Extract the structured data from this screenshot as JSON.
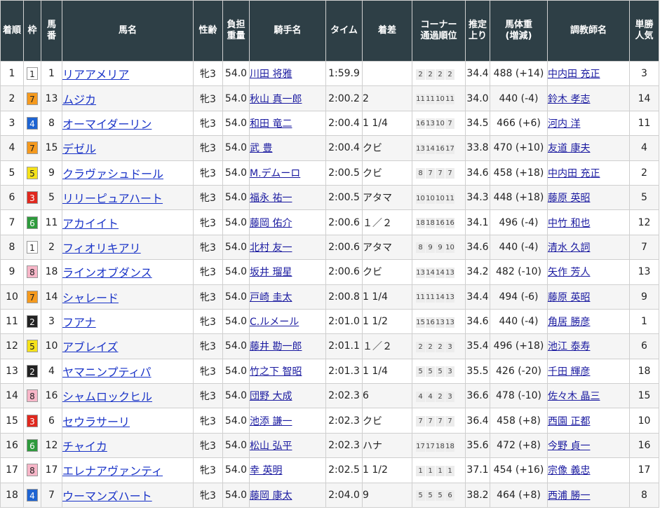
{
  "headers": {
    "rank": "着順",
    "waku": "枠",
    "num": "馬番",
    "horse": "馬名",
    "sexage": "性齢",
    "weight": "負担重量",
    "jockey": "騎手名",
    "time": "タイム",
    "margin": "着差",
    "corner_l1": "コーナー",
    "corner_l2": "通過順位",
    "last3f": "推定上り",
    "body_l1": "馬体重",
    "body_l2": "(増減)",
    "trainer": "調教師名",
    "pop": "単勝人気"
  },
  "waku_colors": {
    "1": {
      "bg": "#ffffff",
      "fg": "#222222"
    },
    "2": {
      "bg": "#222222",
      "fg": "#ffffff"
    },
    "3": {
      "bg": "#e0281e",
      "fg": "#ffffff"
    },
    "4": {
      "bg": "#1e64d2",
      "fg": "#ffffff"
    },
    "5": {
      "bg": "#f5e21a",
      "fg": "#222222"
    },
    "6": {
      "bg": "#2e9a3c",
      "fg": "#ffffff"
    },
    "7": {
      "bg": "#f59a1e",
      "fg": "#222222"
    },
    "8": {
      "bg": "#f7b6c8",
      "fg": "#222222"
    }
  },
  "rows": [
    {
      "rank": "1",
      "waku": "1",
      "num": "1",
      "horse": "リアアメリア",
      "sexage": "牝3",
      "weight": "54.0",
      "jockey": "川田 将雅",
      "time": "1:59.9",
      "margin": "",
      "corner": [
        "2",
        "2",
        "2",
        "2"
      ],
      "last3f": "34.4",
      "body": "488 (+14)",
      "trainer": "中内田 充正",
      "pop": "3"
    },
    {
      "rank": "2",
      "waku": "7",
      "num": "13",
      "horse": "ムジカ",
      "sexage": "牝3",
      "weight": "54.0",
      "jockey": "秋山 真一郎",
      "time": "2:00.2",
      "margin": "2",
      "corner": [
        "11",
        "11",
        "10",
        "11"
      ],
      "last3f": "34.0",
      "body": "440 (-4)",
      "trainer": "鈴木 孝志",
      "pop": "14"
    },
    {
      "rank": "3",
      "waku": "4",
      "num": "8",
      "horse": "オーマイダーリン",
      "sexage": "牝3",
      "weight": "54.0",
      "jockey": "和田 竜二",
      "time": "2:00.4",
      "margin": "1 1/4",
      "corner": [
        "16",
        "13",
        "10",
        "7"
      ],
      "last3f": "34.5",
      "body": "466 (+6)",
      "trainer": "河内 洋",
      "pop": "11"
    },
    {
      "rank": "4",
      "waku": "7",
      "num": "15",
      "horse": "デゼル",
      "sexage": "牝3",
      "weight": "54.0",
      "jockey": "武 豊",
      "time": "2:00.4",
      "margin": "クビ",
      "corner": [
        "13",
        "14",
        "16",
        "17"
      ],
      "last3f": "33.8",
      "body": "470 (+10)",
      "trainer": "友道 康夫",
      "pop": "4"
    },
    {
      "rank": "5",
      "waku": "5",
      "num": "9",
      "horse": "クラヴァシュドール",
      "sexage": "牝3",
      "weight": "54.0",
      "jockey": "M.デムーロ",
      "time": "2:00.5",
      "margin": "クビ",
      "corner": [
        "8",
        "7",
        "7",
        "7"
      ],
      "last3f": "34.6",
      "body": "458 (+18)",
      "trainer": "中内田 充正",
      "pop": "2"
    },
    {
      "rank": "6",
      "waku": "3",
      "num": "5",
      "horse": "リリーピュアハート",
      "sexage": "牝3",
      "weight": "54.0",
      "jockey": "福永 祐一",
      "time": "2:00.5",
      "margin": "アタマ",
      "corner": [
        "10",
        "10",
        "10",
        "11"
      ],
      "last3f": "34.3",
      "body": "448 (+18)",
      "trainer": "藤原 英昭",
      "pop": "5"
    },
    {
      "rank": "7",
      "waku": "6",
      "num": "11",
      "horse": "アカイイト",
      "sexage": "牝3",
      "weight": "54.0",
      "jockey": "藤岡 佑介",
      "time": "2:00.6",
      "margin": "１／２",
      "corner": [
        "18",
        "18",
        "16",
        "16"
      ],
      "last3f": "34.1",
      "body": "496 (-4)",
      "trainer": "中竹 和也",
      "pop": "12"
    },
    {
      "rank": "8",
      "waku": "1",
      "num": "2",
      "horse": "フィオリキアリ",
      "sexage": "牝3",
      "weight": "54.0",
      "jockey": "北村 友一",
      "time": "2:00.6",
      "margin": "アタマ",
      "corner": [
        "8",
        "9",
        "9",
        "10"
      ],
      "last3f": "34.6",
      "body": "440 (-4)",
      "trainer": "清水 久詞",
      "pop": "7"
    },
    {
      "rank": "9",
      "waku": "8",
      "num": "18",
      "horse": "ラインオブダンス",
      "sexage": "牝3",
      "weight": "54.0",
      "jockey": "坂井 瑠星",
      "time": "2:00.6",
      "margin": "クビ",
      "corner": [
        "13",
        "14",
        "14",
        "13"
      ],
      "last3f": "34.2",
      "body": "482 (-10)",
      "trainer": "矢作 芳人",
      "pop": "13"
    },
    {
      "rank": "10",
      "waku": "7",
      "num": "14",
      "horse": "シャレード",
      "sexage": "牝3",
      "weight": "54.0",
      "jockey": "戸崎 圭太",
      "time": "2:00.8",
      "margin": "1 1/4",
      "corner": [
        "11",
        "11",
        "14",
        "13"
      ],
      "last3f": "34.4",
      "body": "494 (-6)",
      "trainer": "藤原 英昭",
      "pop": "9"
    },
    {
      "rank": "11",
      "waku": "2",
      "num": "3",
      "horse": "フアナ",
      "sexage": "牝3",
      "weight": "54.0",
      "jockey": "C.ルメール",
      "time": "2:01.0",
      "margin": "1 1/2",
      "corner": [
        "15",
        "16",
        "13",
        "13"
      ],
      "last3f": "34.6",
      "body": "440 (-4)",
      "trainer": "角居 勝彦",
      "pop": "1"
    },
    {
      "rank": "12",
      "waku": "5",
      "num": "10",
      "horse": "アブレイズ",
      "sexage": "牝3",
      "weight": "54.0",
      "jockey": "藤井 勘一郎",
      "time": "2:01.1",
      "margin": "１／２",
      "corner": [
        "2",
        "2",
        "2",
        "3"
      ],
      "last3f": "35.4",
      "body": "496 (+18)",
      "trainer": "池江 泰寿",
      "pop": "6"
    },
    {
      "rank": "13",
      "waku": "2",
      "num": "4",
      "horse": "ヤマニンプティパ",
      "sexage": "牝3",
      "weight": "54.0",
      "jockey": "竹之下 智昭",
      "time": "2:01.3",
      "margin": "1 1/4",
      "corner": [
        "5",
        "5",
        "5",
        "3"
      ],
      "last3f": "35.5",
      "body": "426 (-20)",
      "trainer": "千田 輝彦",
      "pop": "18"
    },
    {
      "rank": "14",
      "waku": "8",
      "num": "16",
      "horse": "シャムロックヒル",
      "sexage": "牝3",
      "weight": "54.0",
      "jockey": "団野 大成",
      "time": "2:02.3",
      "margin": "6",
      "corner": [
        "4",
        "4",
        "2",
        "3"
      ],
      "last3f": "36.6",
      "body": "478 (-10)",
      "trainer": "佐々木 晶三",
      "pop": "15"
    },
    {
      "rank": "15",
      "waku": "3",
      "num": "6",
      "horse": "セウラサーリ",
      "sexage": "牝3",
      "weight": "54.0",
      "jockey": "池添 謙一",
      "time": "2:02.3",
      "margin": "クビ",
      "corner": [
        "7",
        "7",
        "7",
        "7"
      ],
      "last3f": "36.4",
      "body": "458 (+8)",
      "trainer": "西園 正都",
      "pop": "10"
    },
    {
      "rank": "16",
      "waku": "6",
      "num": "12",
      "horse": "チャイカ",
      "sexage": "牝3",
      "weight": "54.0",
      "jockey": "松山 弘平",
      "time": "2:02.3",
      "margin": "ハナ",
      "corner": [
        "17",
        "17",
        "18",
        "18"
      ],
      "last3f": "35.6",
      "body": "472 (+8)",
      "trainer": "今野 貞一",
      "pop": "16"
    },
    {
      "rank": "17",
      "waku": "8",
      "num": "17",
      "horse": "エレナアヴァンティ",
      "sexage": "牝3",
      "weight": "54.0",
      "jockey": "幸 英明",
      "time": "2:02.5",
      "margin": "1 1/2",
      "corner": [
        "1",
        "1",
        "1",
        "1"
      ],
      "last3f": "37.1",
      "body": "454 (+16)",
      "trainer": "宗像 義忠",
      "pop": "17"
    },
    {
      "rank": "18",
      "waku": "4",
      "num": "7",
      "horse": "ウーマンズハート",
      "sexage": "牝3",
      "weight": "54.0",
      "jockey": "藤岡 康太",
      "time": "2:04.0",
      "margin": "9",
      "corner": [
        "5",
        "5",
        "5",
        "6"
      ],
      "last3f": "38.2",
      "body": "464 (+8)",
      "trainer": "西浦 勝一",
      "pop": "8"
    }
  ]
}
